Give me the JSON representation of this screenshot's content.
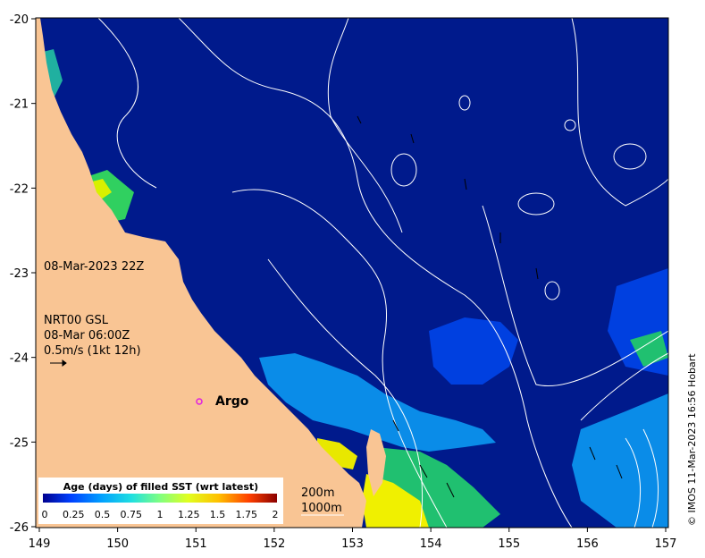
{
  "map": {
    "timestamp": "08-Mar-2023 22Z",
    "current_product": "NRT00 GSL",
    "current_time": "08-Mar 06:00Z",
    "current_scale": "0.5m/s (1kt 12h)",
    "argo_label": "Argo",
    "credit": "© IMOS 11-Mar-2023 16:56 Hobart",
    "isobaths": [
      "200m",
      "1000m"
    ],
    "x_ticks": [
      "149",
      "150",
      "151",
      "152",
      "153",
      "154",
      "155",
      "156",
      "157"
    ],
    "y_ticks": [
      "-20",
      "-21",
      "-22",
      "-23",
      "-24",
      "-25",
      "-26"
    ],
    "colorbar": {
      "title": "Age (days) of filled SST (wrt latest)",
      "ticks": [
        "0",
        "0.25",
        "0.5",
        "0.75",
        "1",
        "1.25",
        "1.5",
        "1.75",
        "2"
      ],
      "colors": [
        "#00008f",
        "#0050ff",
        "#00b0ff",
        "#30ffc0",
        "#a0ff60",
        "#ffff00",
        "#ffa000",
        "#ff3000",
        "#800000"
      ]
    },
    "colors": {
      "ocean": "#001a8c",
      "land": "#f9c594"
    }
  }
}
